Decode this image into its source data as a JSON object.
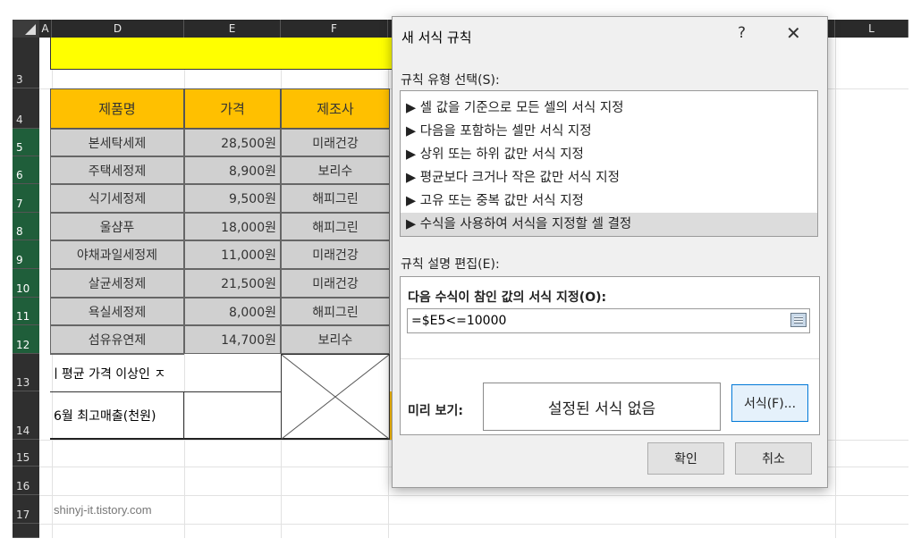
{
  "sheet": {
    "columns": [
      "A",
      "D",
      "E",
      "F",
      "L"
    ],
    "rows": [
      "3",
      "4",
      "5",
      "6",
      "7",
      "8",
      "9",
      "10",
      "11",
      "12",
      "13",
      "14",
      "15",
      "16",
      "17"
    ],
    "table_headers": [
      "제품명",
      "가격",
      "제조사"
    ],
    "table_rows": [
      {
        "name": "본세탁세제",
        "price": "28,500원",
        "maker": "미래건강"
      },
      {
        "name": "주택세정제",
        "price": "8,900원",
        "maker": "보리수"
      },
      {
        "name": "식기세정제",
        "price": "9,500원",
        "maker": "해피그린"
      },
      {
        "name": "울샴푸",
        "price": "18,000원",
        "maker": "해피그린"
      },
      {
        "name": "야채과일세정제",
        "price": "11,000원",
        "maker": "미래건강"
      },
      {
        "name": "살균세정제",
        "price": "21,500원",
        "maker": "미래건강"
      },
      {
        "name": "욕실세정제",
        "price": "8,000원",
        "maker": "해피그린"
      },
      {
        "name": "섬유유연제",
        "price": "14,700원",
        "maker": "보리수"
      }
    ],
    "row13_text": "ㅣ평균 가격 이상인 ㅈ",
    "row14_text": "6월 최고매출(천원)",
    "watermark": "shinyj-it.tistory.com",
    "colors": {
      "header_fill": "#ffc000",
      "title_fill": "#ffff00",
      "data_fill": "#d0d0d0",
      "selected_row": "#1f5e3a"
    }
  },
  "dialog": {
    "title": "새 서식 규칙",
    "help": "?",
    "close": "✕",
    "rule_type_label": "규칙 유형 선택(S):",
    "rule_types": [
      "▶ 셀 값을 기준으로 모든 셀의 서식 지정",
      "▶ 다음을 포함하는 셀만 서식 지정",
      "▶ 상위 또는 하위 값만 서식 지정",
      "▶ 평균보다 크거나 작은 값만 서식 지정",
      "▶ 고유 또는 중복 값만 서식 지정",
      "▶ 수식을 사용하여 서식을 지정할 셀 결정"
    ],
    "selected_rule_index": 5,
    "desc_label": "규칙 설명 편집(E):",
    "formula_label": "다음 수식이 참인 값의 서식 지정(O):",
    "formula_value": "=$E5<=10000",
    "preview_label": "미리 보기:",
    "preview_text": "설정된 서식 없음",
    "format_button": "서식(F)...",
    "ok_button": "확인",
    "cancel_button": "취소",
    "icons": {
      "reference": "range-select-icon",
      "cursor": "mouse-pointer-icon"
    }
  }
}
